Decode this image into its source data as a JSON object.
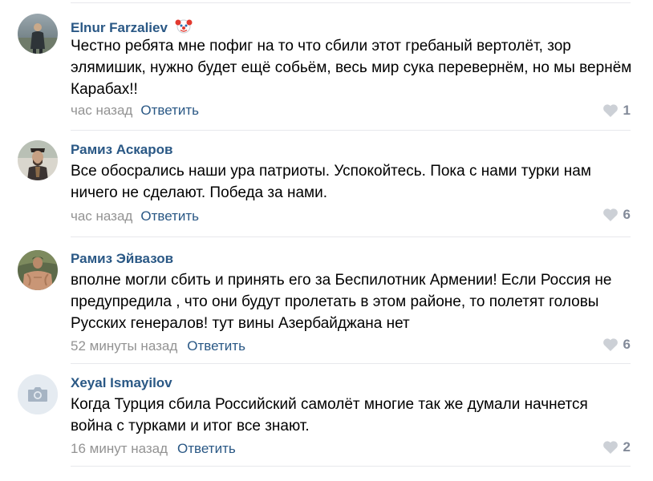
{
  "comments": [
    {
      "author": "Elnur Farzaliev",
      "text": "Честно ребята мне пофиг на то что сбили этот гребаный вертолёт, зор элямишик, нужно будет ещё собьём, весь мир сука перевернём, но мы вернём Карабах!!",
      "time": "час назад",
      "reply": "Ответить",
      "likes": "1",
      "avatar": "person-photo-avatar",
      "author_emoji": "clown-face-icon"
    },
    {
      "author": "Рамиз Аскаров",
      "text": "Все обосрались наши ура патриоты. Успокойтесь. Пока с нами турки нам ничего не сделают. Победа за нами.",
      "time": "час назад",
      "reply": "Ответить",
      "likes": "6",
      "avatar": "person-photo-avatar"
    },
    {
      "author": "Рамиз Эйвазов",
      "text": "вполне могли сбить и принять его за Беспилотник Армении! Если Россия не предупредила , что они будут пролетать в этом районе, то полетят головы Русских генералов! тут вины Азербайджана нет",
      "time": "52 минуты назад",
      "reply": "Ответить",
      "likes": "6",
      "avatar": "person-photo-avatar"
    },
    {
      "author": "Xeyal Ismayilov",
      "text": "Когда Турция сбила Российский самолёт многие так же думали начнется война с турками и итог все знают.",
      "time": "16 минут назад",
      "reply": "Ответить",
      "likes": "2",
      "avatar": "camera-placeholder-icon"
    }
  ],
  "colors": {
    "link": "#2a5885",
    "meta": "#939393",
    "like": "#828a99",
    "divider": "#e7e8ec"
  }
}
